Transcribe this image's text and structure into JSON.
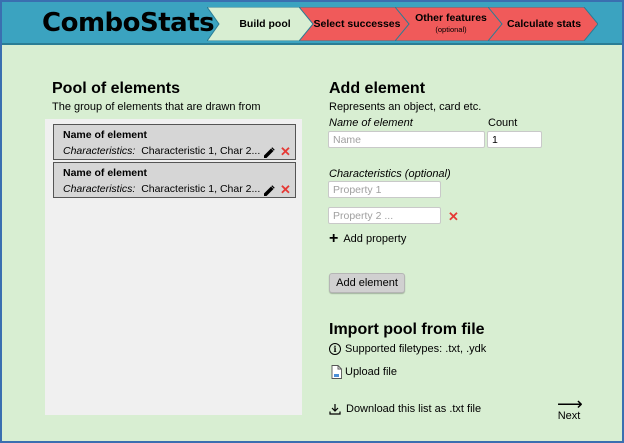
{
  "app": {
    "title": "ComboStats"
  },
  "steps": [
    {
      "label": "Build pool",
      "sub": "",
      "color": "#d8eed2"
    },
    {
      "label": "Select successes",
      "sub": "",
      "color": "#f05a5a"
    },
    {
      "label": "Other features",
      "sub": "(optional)",
      "color": "#f05a5a"
    },
    {
      "label": "Calculate stats",
      "sub": "",
      "color": "#f05a5a"
    }
  ],
  "pool": {
    "title": "Pool of elements",
    "subtitle": "The group of elements that are drawn from",
    "items": [
      {
        "name": "Name of element",
        "chars_label": "Characteristics:",
        "chars": "Characteristic 1, Char 2..."
      },
      {
        "name": "Name of element",
        "chars_label": "Characteristics:",
        "chars": "Characteristic 1, Char 2..."
      }
    ]
  },
  "add": {
    "title": "Add element",
    "subtitle": "Represents an object, card etc.",
    "name_label": "Name of element",
    "name_placeholder": "Name",
    "count_label": "Count",
    "count_value": "1",
    "chars_label": "Characteristics (optional)",
    "prop1_placeholder": "Property 1",
    "prop2_placeholder": "Property 2 ...",
    "add_property": "Add property",
    "button": "Add element"
  },
  "import": {
    "title": "Import pool from file",
    "filetypes": "Supported filetypes: .txt, .ydk",
    "upload": "Upload file",
    "download": "Download this list as .txt file"
  },
  "nav": {
    "next": "Next"
  },
  "colors": {
    "header": "#3ba3c0",
    "background": "#d8eed2",
    "step_active": "#d8eed2",
    "step_inactive": "#f05a5a",
    "remove": "#e53935"
  }
}
